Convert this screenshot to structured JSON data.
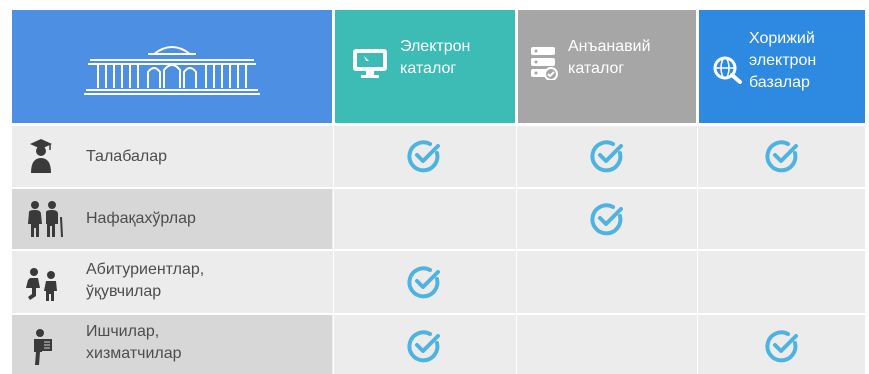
{
  "header": {
    "columns": [
      {
        "lines": [
          "Электрон",
          "каталог"
        ],
        "color": "#3cbcb4",
        "icon": "monitor-icon"
      },
      {
        "lines": [
          "Анъанавий",
          "каталог"
        ],
        "color": "#a6a6a6",
        "icon": "database-server-icon"
      },
      {
        "lines": [
          "Хорижий",
          "электрон",
          "базалар"
        ],
        "color": "#2e8ae1",
        "icon": "globe-search-icon"
      }
    ],
    "building_icon": "university-building-icon",
    "building_color": "#4d8fe3"
  },
  "rows": [
    {
      "lines": [
        "Талабалар"
      ],
      "icon": "graduate-student-icon",
      "checks": [
        true,
        true,
        true
      ]
    },
    {
      "lines": [
        "Нафақахўрлар"
      ],
      "icon": "elderly-couple-icon",
      "checks": [
        false,
        true,
        false
      ]
    },
    {
      "lines": [
        "Абитуриентлар,",
        "ўқувчилар"
      ],
      "icon": "applicants-pupils-icon",
      "checks": [
        true,
        false,
        false
      ]
    },
    {
      "lines": [
        "Ишчилар,",
        "хизматчилар"
      ],
      "icon": "worker-icon",
      "checks": [
        true,
        false,
        true
      ]
    }
  ],
  "check_color": "#4fb3e0",
  "row_color": "#ececec"
}
